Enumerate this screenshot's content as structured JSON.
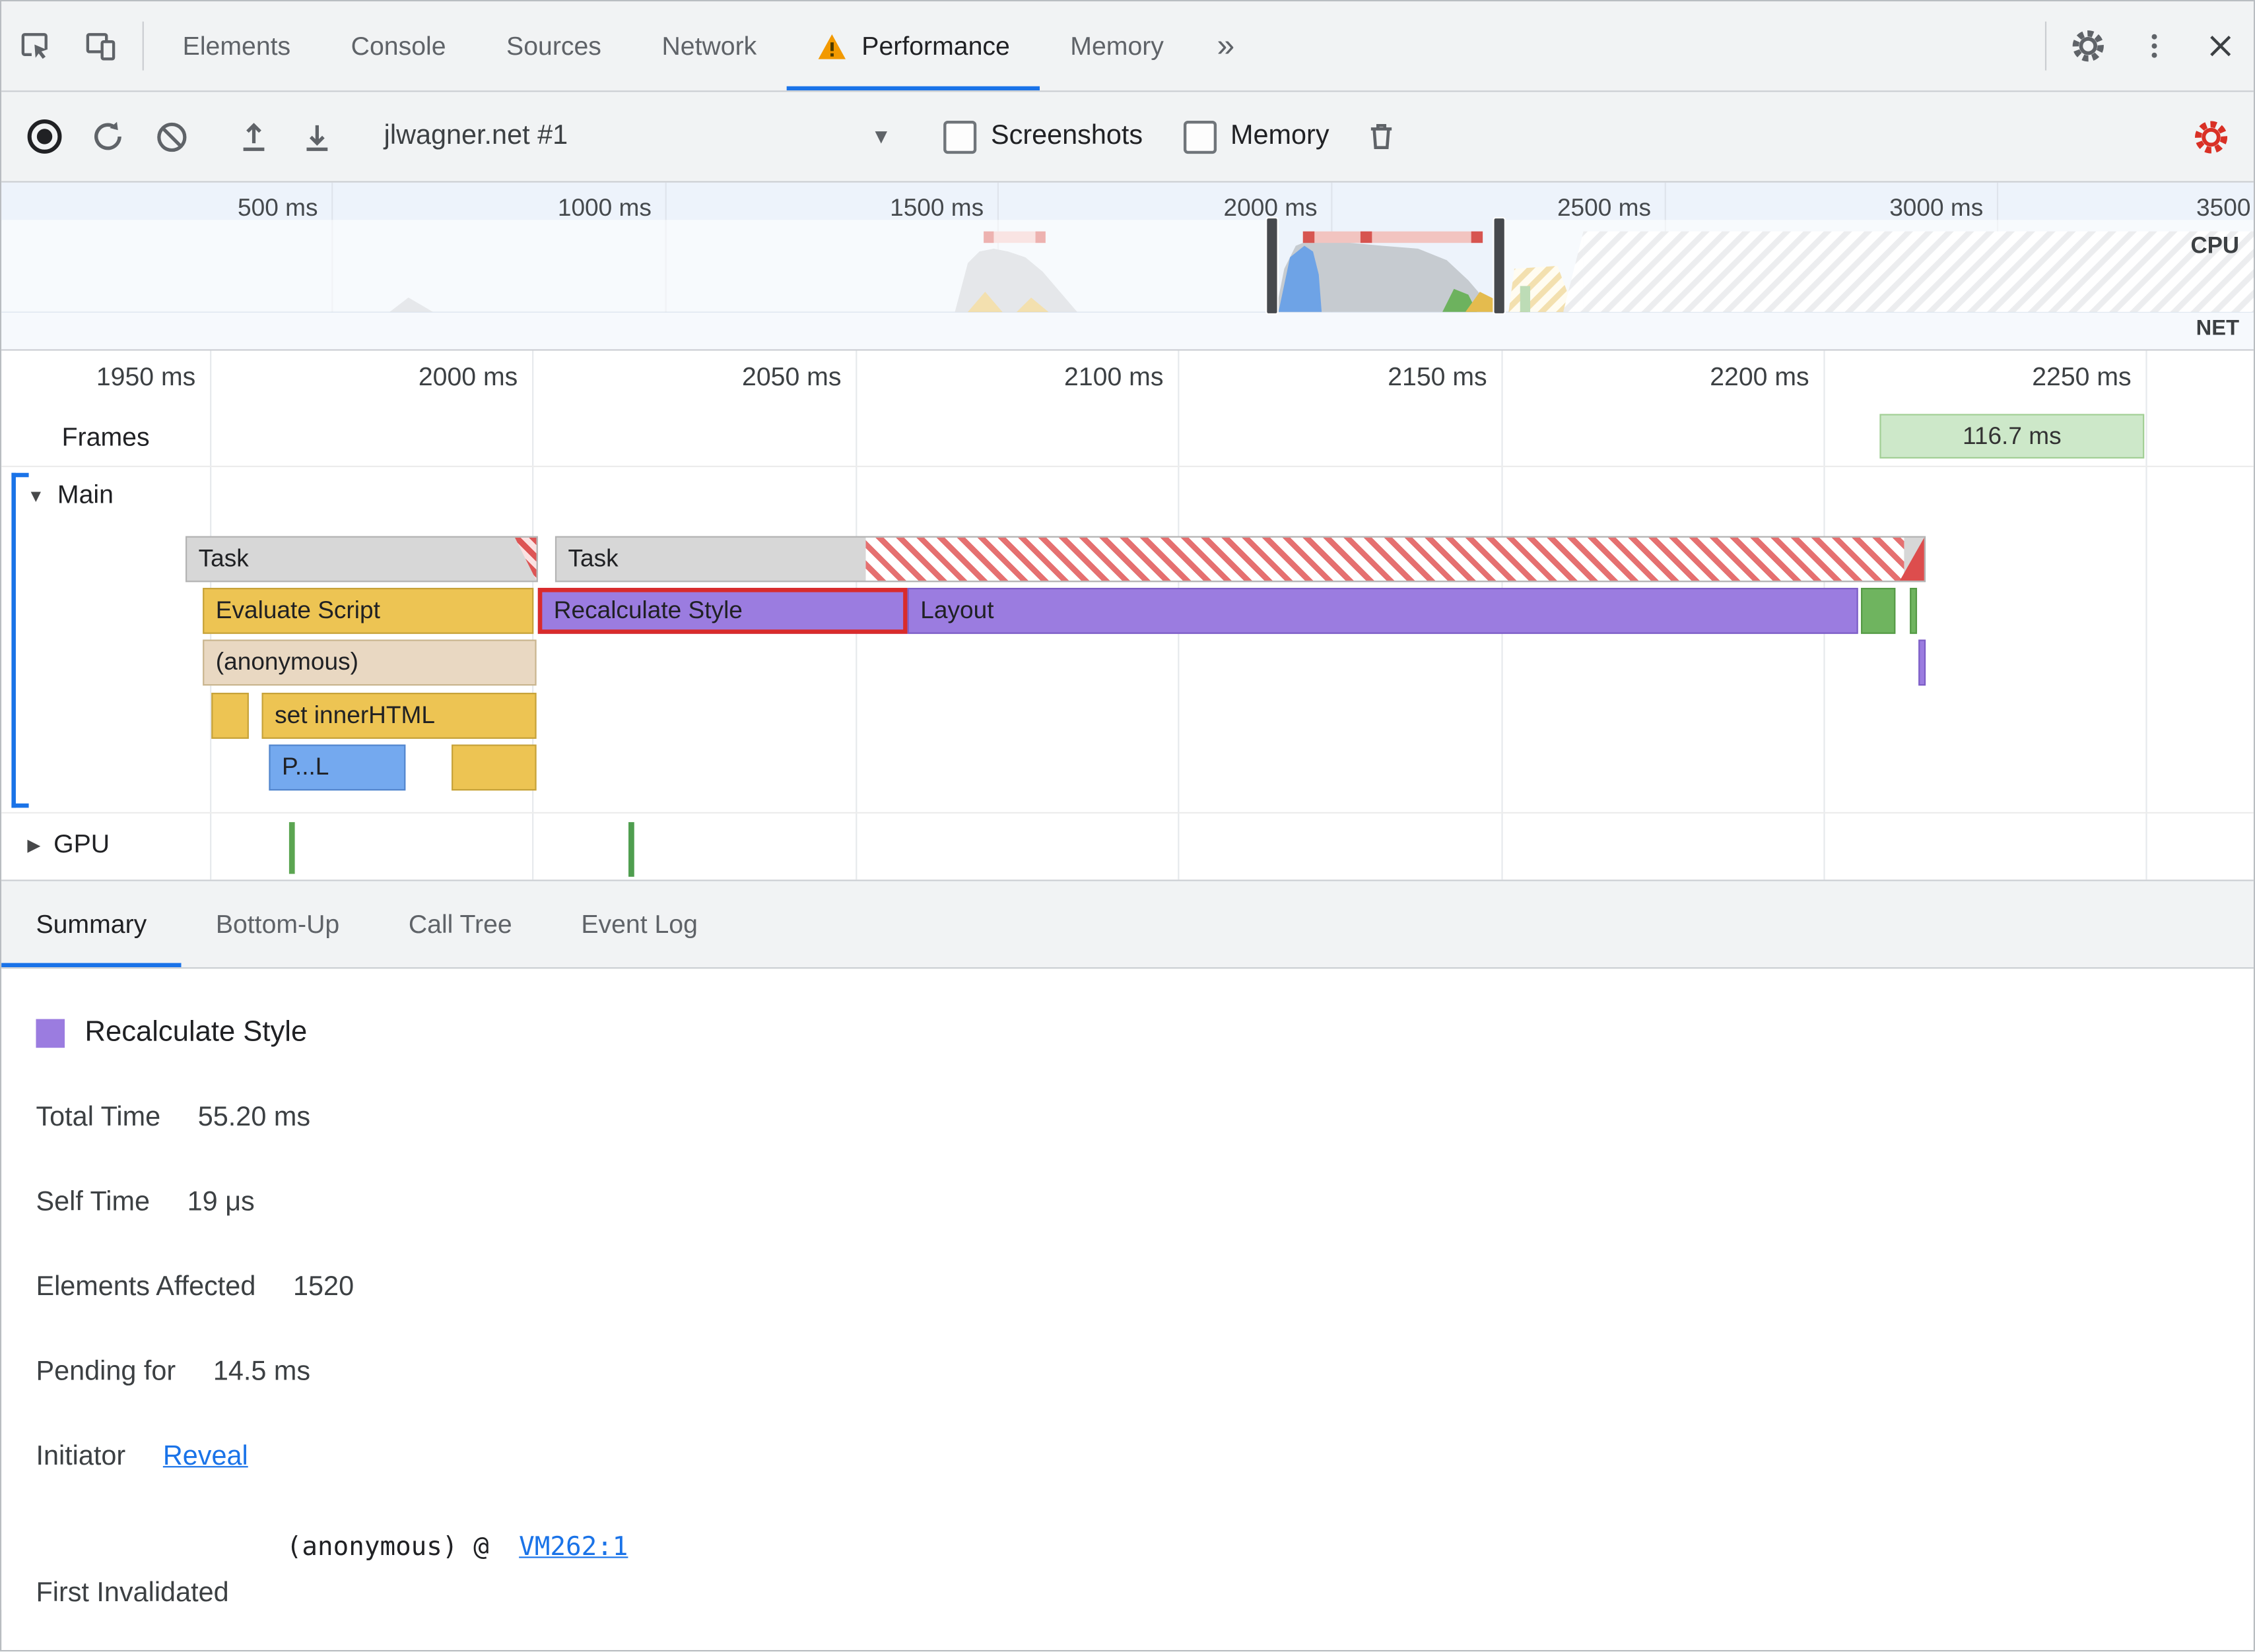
{
  "tabbar": {
    "tabs": [
      "Elements",
      "Console",
      "Sources",
      "Network",
      "Performance",
      "Memory"
    ],
    "overflow": "»"
  },
  "toolbar": {
    "profile": "jlwagner.net #1",
    "screenshots": "Screenshots",
    "memory": "Memory"
  },
  "overview": {
    "ticks": [
      "500 ms",
      "1000 ms",
      "1500 ms",
      "2000 ms",
      "2500 ms",
      "3000 ms",
      "3500"
    ],
    "cpu": "CPU",
    "net": "NET"
  },
  "timeline": {
    "ticks": [
      "1950 ms",
      "2000 ms",
      "2050 ms",
      "2100 ms",
      "2150 ms",
      "2200 ms",
      "2250 ms"
    ],
    "frames_label": "Frames",
    "frame_value": "116.7 ms",
    "main_label": "Main",
    "gpu_label": "GPU"
  },
  "flame": {
    "task1": "Task",
    "task2": "Task",
    "evaluate_script": "Evaluate Script",
    "recalculate_style": "Recalculate Style",
    "layout": "Layout",
    "anonymous": "(anonymous)",
    "set_inner_html": "set innerHTML",
    "parse_html": "P...L"
  },
  "bottom_tabs": [
    "Summary",
    "Bottom-Up",
    "Call Tree",
    "Event Log"
  ],
  "summary": {
    "title": "Recalculate Style",
    "rows": [
      {
        "label": "Total Time",
        "value": "55.20 ms"
      },
      {
        "label": "Self Time",
        "value": "19 μs"
      },
      {
        "label": "Elements Affected",
        "value": "1520"
      },
      {
        "label": "Pending for",
        "value": "14.5 ms"
      }
    ],
    "initiator_label": "Initiator",
    "initiator_link": "Reveal",
    "first_invalidated_label": "First Invalidated",
    "stack_text": "(anonymous) @",
    "stack_link": "VM262:1"
  },
  "colors": {
    "accent": "#1a73e8",
    "warning": "#f29900",
    "selection_red": "#d92b2b",
    "scripting_yellow": "#edc453",
    "rendering_purple": "#9b7ce0",
    "painting_green": "#6fb45f",
    "task_gray": "#d7d7d7",
    "frame_green": "#cde8c9"
  }
}
